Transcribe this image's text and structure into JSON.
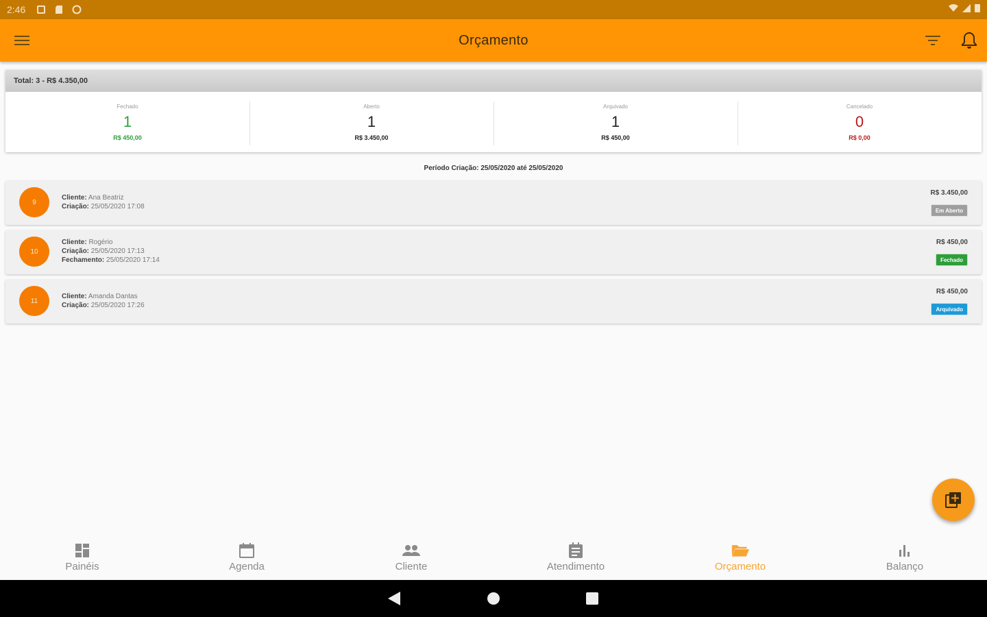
{
  "status_bar": {
    "time": "2:46"
  },
  "app_bar": {
    "title": "Orçamento"
  },
  "summary": {
    "total": "Total: 3 - R$ 4.350,00",
    "stats": [
      {
        "label": "Fechado",
        "count": "1",
        "value": "R$ 450,00",
        "color": "#2e9e3a"
      },
      {
        "label": "Aberto",
        "count": "1",
        "value": "R$ 3.450,00",
        "color": "#222222"
      },
      {
        "label": "Arquivado",
        "count": "1",
        "value": "R$ 450,00",
        "color": "#222222"
      },
      {
        "label": "Cancelado",
        "count": "0",
        "value": "R$ 0,00",
        "color": "#b71c1c"
      }
    ]
  },
  "period": "Período Criação: 25/05/2020 até 25/05/2020",
  "budgets": [
    {
      "number": "9",
      "lines": [
        {
          "key": "Cliente:",
          "val": "Ana Beatriz"
        },
        {
          "key": "Criação:",
          "val": "25/05/2020 17:08"
        }
      ],
      "amount": "R$ 3.450,00",
      "status": "Em Aberto",
      "status_color": "#9e9e9e"
    },
    {
      "number": "10",
      "lines": [
        {
          "key": "Cliente:",
          "val": "Rogério"
        },
        {
          "key": "Criação:",
          "val": "25/05/2020 17:13"
        },
        {
          "key": "Fechamento:",
          "val": "25/05/2020 17:14"
        }
      ],
      "amount": "R$ 450,00",
      "status": "Fechado",
      "status_color": "#2e9e3a"
    },
    {
      "number": "11",
      "lines": [
        {
          "key": "Cliente:",
          "val": "Amanda Dantas"
        },
        {
          "key": "Criação:",
          "val": "25/05/2020 17:26"
        }
      ],
      "amount": "R$ 450,00",
      "status": "Arquivado",
      "status_color": "#1e9ad6"
    }
  ],
  "bottom_nav": [
    {
      "label": "Painéis",
      "icon": "dashboard-icon",
      "active": false
    },
    {
      "label": "Agenda",
      "icon": "calendar-icon",
      "active": false
    },
    {
      "label": "Cliente",
      "icon": "people-icon",
      "active": false
    },
    {
      "label": "Atendimento",
      "icon": "assignment-icon",
      "active": false
    },
    {
      "label": "Orçamento",
      "icon": "folder-open-icon",
      "active": true
    },
    {
      "label": "Balanço",
      "icon": "bar-chart-icon",
      "active": false
    }
  ],
  "colors": {
    "primary": "#ff9505",
    "status_bar": "#c47900",
    "accent": "#f57c00",
    "nav_inactive": "#8a8a8a",
    "nav_active": "#f7a531"
  }
}
